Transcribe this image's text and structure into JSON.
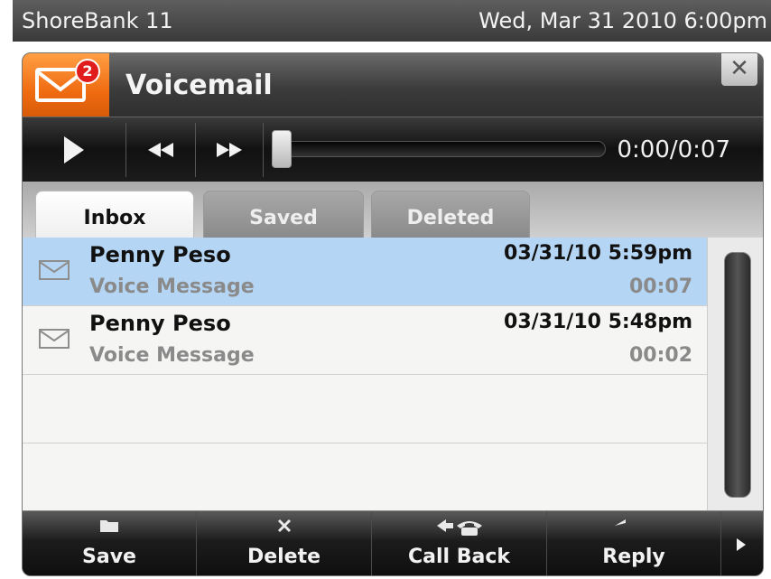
{
  "status_bar": {
    "device_name": "ShoreBank 11",
    "datetime": "Wed, Mar 31 2010 6:00pm"
  },
  "window": {
    "title": "Voicemail",
    "unread_badge": "2",
    "close_label": "✕"
  },
  "player": {
    "time": "0:00/0:07",
    "progress": 0
  },
  "tabs": [
    {
      "label": "Inbox",
      "active": true
    },
    {
      "label": "Saved",
      "active": false
    },
    {
      "label": "Deleted",
      "active": false
    }
  ],
  "messages": [
    {
      "caller": "Penny Peso",
      "type": "Voice Message",
      "datetime": "03/31/10 5:59pm",
      "duration": "00:07",
      "selected": true
    },
    {
      "caller": "Penny Peso",
      "type": "Voice Message",
      "datetime": "03/31/10 5:48pm",
      "duration": "00:02",
      "selected": false
    }
  ],
  "softkeys": [
    {
      "label": "Save",
      "icon": "folder-icon"
    },
    {
      "label": "Delete",
      "icon": "x-icon"
    },
    {
      "label": "Call Back",
      "icon": "call-back-icon"
    },
    {
      "label": "Reply",
      "icon": "reply-arrow-icon"
    }
  ],
  "colors": {
    "app_icon": "#f06c12",
    "selected_row": "#b5d5f4",
    "badge": "#e01c1c"
  }
}
